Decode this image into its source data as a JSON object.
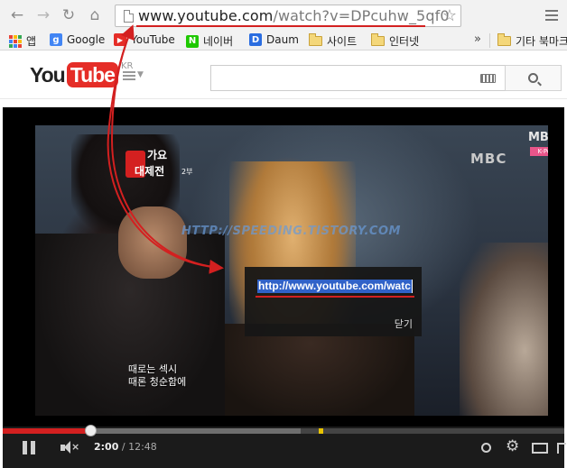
{
  "browser": {
    "url_host": "www.youtube.com",
    "url_path": "/watch?v=DPcuhw_5qf0",
    "bookmarks": [
      {
        "label": "앱",
        "icon": "apps-grid-icon"
      },
      {
        "label": "Google",
        "icon": "google-icon"
      },
      {
        "label": "YouTube",
        "icon": "youtube-icon"
      },
      {
        "label": "네이버",
        "icon": "naver-icon"
      },
      {
        "label": "Daum",
        "icon": "daum-icon"
      },
      {
        "label": "사이트",
        "icon": "folder-icon"
      },
      {
        "label": "인터넷",
        "icon": "folder-icon"
      }
    ],
    "overflow_label": "»",
    "other_bookmarks": "기타 북마크"
  },
  "youtube": {
    "logo_you": "You",
    "logo_tube": "Tube",
    "region": "KR",
    "search": {
      "value": "",
      "placeholder": ""
    }
  },
  "video": {
    "show_title_line1": "가요",
    "show_title_line2": "대제전",
    "show_episode": "2부",
    "channel_logo": "MBC",
    "channel_logo_top": "MBC",
    "channel_sub": "K-Pop",
    "watermark": "HTTP://SPEEDING.TISTORY.COM",
    "subtitle_line1": "때로는 섹시",
    "subtitle_line2": "때론 청순함에"
  },
  "share_dialog": {
    "url_value": "http://www.youtube.com/watc",
    "close_label": "닫기"
  },
  "player": {
    "current_time": "2:00",
    "separator": " / ",
    "duration": "12:48",
    "played_fraction": 0.156,
    "buffered_fraction": 0.53
  },
  "colors": {
    "accent_red": "#d32020",
    "youtube_red": "#e52d27",
    "selection_blue": "#3062c8"
  }
}
